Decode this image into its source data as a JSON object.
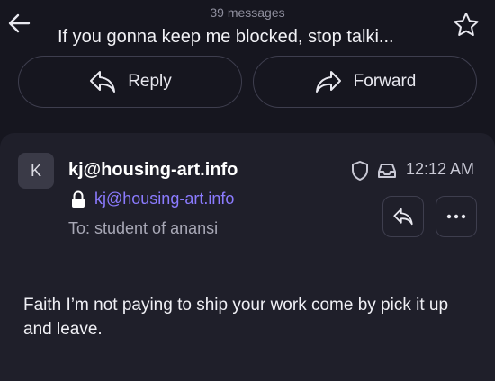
{
  "header": {
    "message_count": "39 messages",
    "subject": "If you gonna keep me blocked, stop talki...",
    "reply_label": "Reply",
    "forward_label": "Forward"
  },
  "message": {
    "avatar_initial": "K",
    "sender_name": "kj@housing-art.info",
    "sender_email": "kj@housing-art.info",
    "to": "To: student of anansi",
    "time": "12:12 AM",
    "body": "Faith I’m not paying to ship your work come by pick it up and leave."
  },
  "icons": {
    "back": "arrow-left-icon",
    "star": "star-icon",
    "reply": "reply-icon",
    "forward": "forward-icon",
    "lock": "lock-icon",
    "shield": "shield-icon",
    "inbox": "inbox-icon",
    "more": "more-icon"
  },
  "colors": {
    "background": "#16161f",
    "card": "#1f1f2a",
    "accent_link": "#8b7bff",
    "border": "#3e3e4e"
  }
}
